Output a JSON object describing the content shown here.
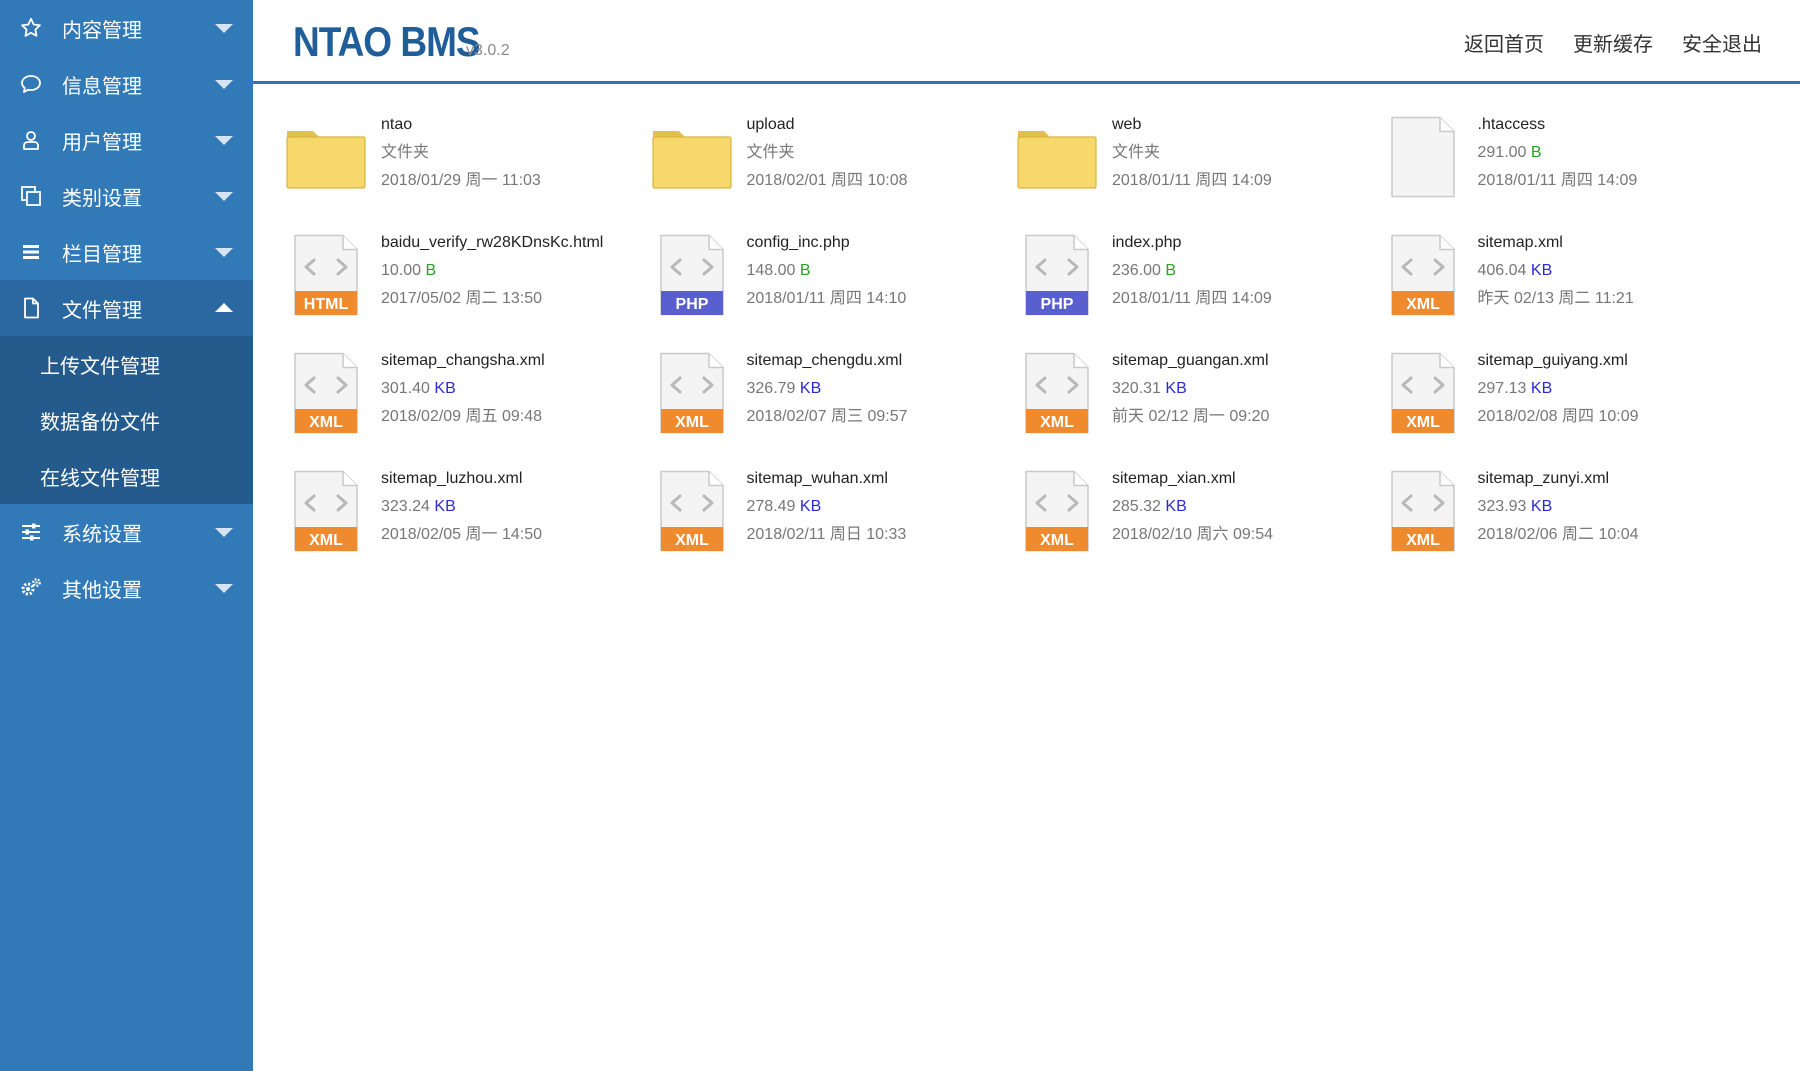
{
  "sidebar": {
    "items": [
      {
        "label": "内容管理",
        "icon": "star-icon"
      },
      {
        "label": "信息管理",
        "icon": "chat-bubble-icon"
      },
      {
        "label": "用户管理",
        "icon": "user-icon"
      },
      {
        "label": "类别设置",
        "icon": "copy-icon"
      },
      {
        "label": "栏目管理",
        "icon": "list-icon"
      },
      {
        "label": "文件管理",
        "icon": "file-icon"
      },
      {
        "label": "系统设置",
        "icon": "sliders-icon"
      },
      {
        "label": "其他设置",
        "icon": "gears-icon"
      }
    ],
    "active_item": "文件管理",
    "sub_items": [
      {
        "label": "上传文件管理"
      },
      {
        "label": "数据备份文件"
      },
      {
        "label": "在线文件管理"
      }
    ]
  },
  "header": {
    "brand": "NTAO BMS",
    "version": "v3.0.2",
    "links": {
      "home": "返回首页",
      "refresh_cache": "更新缓存",
      "logout": "安全退出"
    }
  },
  "colors": {
    "sidebar_bg": "#3279b8",
    "sidebar_active_bg": "#2b68a1",
    "sidebar_sub_bg": "#245a8c",
    "header_rule": "#2f73b2",
    "brand_text": "#1f5e99",
    "unit_b": "#28a228",
    "unit_kb": "#2b2bd6",
    "badge_html": "#f08a2e",
    "badge_php": "#5a5fd0",
    "badge_xml": "#f08a2e",
    "folder": "#f6d86b"
  },
  "files": [
    {
      "name": "ntao",
      "kind": "folder",
      "meta": "文件夹",
      "date": "2018/01/29 周一 11:03"
    },
    {
      "name": "upload",
      "kind": "folder",
      "meta": "文件夹",
      "date": "2018/02/01 周四 10:08"
    },
    {
      "name": "web",
      "kind": "folder",
      "meta": "文件夹",
      "date": "2018/01/11 周四 14:09"
    },
    {
      "name": ".htaccess",
      "kind": "blank",
      "size": "291.00",
      "unit": "B",
      "date": "2018/01/11 周四 14:09"
    },
    {
      "name": "baidu_verify_rw28KDnsKc.html",
      "kind": "code",
      "badge": "HTML",
      "size": "10.00",
      "unit": "B",
      "date": "2017/05/02 周二 13:50"
    },
    {
      "name": "config_inc.php",
      "kind": "code",
      "badge": "PHP",
      "size": "148.00",
      "unit": "B",
      "date": "2018/01/11 周四 14:10"
    },
    {
      "name": "index.php",
      "kind": "code",
      "badge": "PHP",
      "size": "236.00",
      "unit": "B",
      "date": "2018/01/11 周四 14:09"
    },
    {
      "name": "sitemap.xml",
      "kind": "code",
      "badge": "XML",
      "size": "406.04",
      "unit": "KB",
      "date": "昨天 02/13 周二 11:21"
    },
    {
      "name": "sitemap_changsha.xml",
      "kind": "code",
      "badge": "XML",
      "size": "301.40",
      "unit": "KB",
      "date": "2018/02/09 周五 09:48"
    },
    {
      "name": "sitemap_chengdu.xml",
      "kind": "code",
      "badge": "XML",
      "size": "326.79",
      "unit": "KB",
      "date": "2018/02/07 周三 09:57"
    },
    {
      "name": "sitemap_guangan.xml",
      "kind": "code",
      "badge": "XML",
      "size": "320.31",
      "unit": "KB",
      "date": "前天 02/12 周一 09:20"
    },
    {
      "name": "sitemap_guiyang.xml",
      "kind": "code",
      "badge": "XML",
      "size": "297.13",
      "unit": "KB",
      "date": "2018/02/08 周四 10:09"
    },
    {
      "name": "sitemap_luzhou.xml",
      "kind": "code",
      "badge": "XML",
      "size": "323.24",
      "unit": "KB",
      "date": "2018/02/05 周一 14:50"
    },
    {
      "name": "sitemap_wuhan.xml",
      "kind": "code",
      "badge": "XML",
      "size": "278.49",
      "unit": "KB",
      "date": "2018/02/11 周日 10:33"
    },
    {
      "name": "sitemap_xian.xml",
      "kind": "code",
      "badge": "XML",
      "size": "285.32",
      "unit": "KB",
      "date": "2018/02/10 周六 09:54"
    },
    {
      "name": "sitemap_zunyi.xml",
      "kind": "code",
      "badge": "XML",
      "size": "323.93",
      "unit": "KB",
      "date": "2018/02/06 周二 10:04"
    }
  ]
}
